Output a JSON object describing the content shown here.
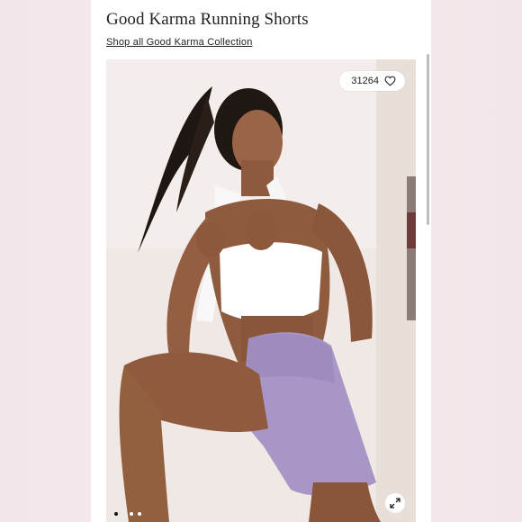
{
  "product": {
    "title": "Good Karma Running Shorts",
    "shop_link": "Shop all Good Karma Collection"
  },
  "gallery": {
    "like_count": "31264",
    "like_icon": "heart-outline-icon",
    "expand_icon": "expand-arrows-icon",
    "total_slides": 3,
    "active_slide": 1
  },
  "colors": {
    "background": "#f4e8ec",
    "panel": "#ffffff",
    "shorts": "#a693c4",
    "text": "#222222"
  }
}
